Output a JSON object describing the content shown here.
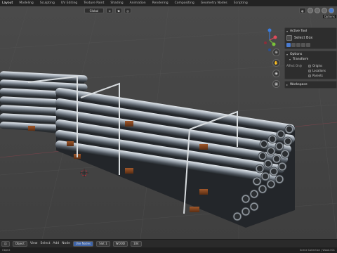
{
  "topbar": {
    "workspaces": [
      "Layout",
      "Modeling",
      "Sculpting",
      "UV Editing",
      "Texture Paint",
      "Shading",
      "Animation",
      "Rendering",
      "Compositing",
      "Geometry Nodes",
      "Scripting"
    ],
    "active_index": 0
  },
  "viewport_header": {
    "orientation": "Global",
    "options": "Options"
  },
  "npanel": {
    "active_tool": "Active Tool",
    "tool_name": "Select Box",
    "options": "Options",
    "transform": "Transform",
    "affect_only": "Affect Only",
    "origins": "Origins",
    "locations": "Locations",
    "parents": "Parents",
    "workspace": "Workspace"
  },
  "bottombar": {
    "mode": "Object",
    "view": "View",
    "select": "Select",
    "add": "Add",
    "node": "Node",
    "use_nodes": "Use Nodes",
    "slot": "Slot 1",
    "material": "WOOD",
    "users": "104"
  },
  "statusbar": {
    "left": "Object",
    "right": "Scene Collection | Wood.001"
  },
  "colors": {
    "accent": "#4a7bd0",
    "axis_x": "#e04a5a",
    "axis_y": "#7ac43a",
    "axis_z": "#3a7de0"
  }
}
